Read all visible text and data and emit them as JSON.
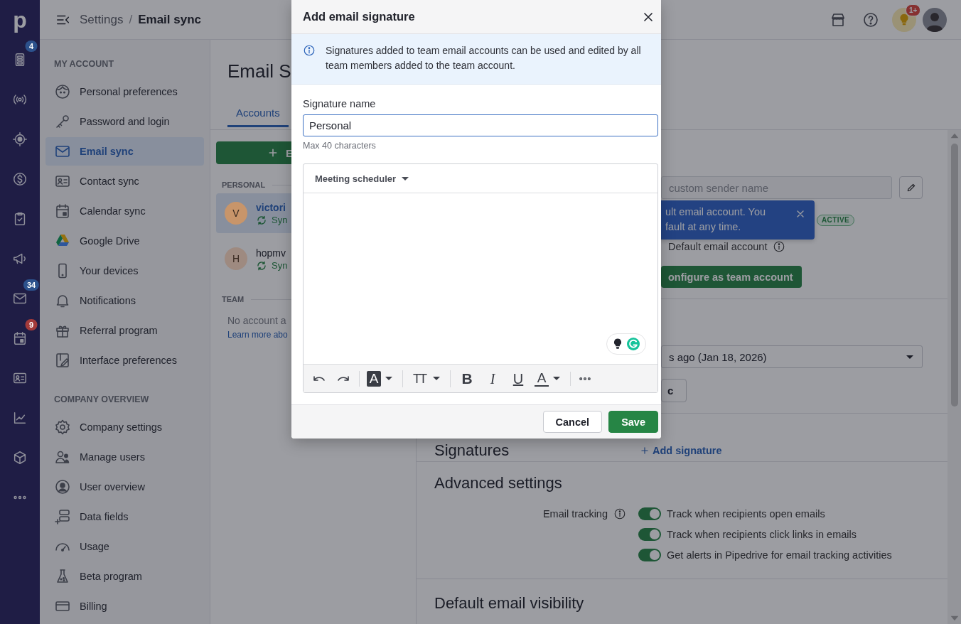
{
  "rail": {
    "logo": "p",
    "items": [
      {
        "kind": "inbox-list",
        "badge": "4",
        "color": "#2c518c"
      },
      {
        "kind": "broadcast"
      },
      {
        "kind": "target"
      },
      {
        "kind": "dollar"
      },
      {
        "kind": "clipboard"
      },
      {
        "kind": "megaphone"
      },
      {
        "kind": "mail",
        "badge": "34",
        "color": "#2c518c"
      },
      {
        "kind": "calendar",
        "badge": "9",
        "color": "#a33a3a"
      },
      {
        "kind": "contact-card"
      },
      {
        "kind": "chart"
      },
      {
        "kind": "box"
      },
      {
        "kind": "more"
      }
    ]
  },
  "header": {
    "breadcrumb": [
      "Settings",
      "Email sync"
    ],
    "separator": "/",
    "tips_badge": "1+"
  },
  "sidebar": {
    "sections": [
      {
        "title": "MY ACCOUNT",
        "items": [
          {
            "label": "Personal preferences",
            "kind": "face",
            "selected": false
          },
          {
            "label": "Password and login",
            "kind": "key",
            "selected": false
          },
          {
            "label": "Email sync",
            "kind": "mail",
            "selected": true
          },
          {
            "label": "Contact sync",
            "kind": "contact-card",
            "selected": false
          },
          {
            "label": "Calendar sync",
            "kind": "calendar",
            "selected": false
          },
          {
            "label": "Google Drive",
            "kind": "triangle",
            "selected": false
          },
          {
            "label": "Your devices",
            "kind": "phone",
            "selected": false
          },
          {
            "label": "Notifications",
            "kind": "bell",
            "selected": false
          },
          {
            "label": "Referral program",
            "kind": "gift",
            "selected": false
          },
          {
            "label": "Interface preferences",
            "kind": "panel-pencil",
            "selected": false
          }
        ]
      },
      {
        "title": "COMPANY OVERVIEW",
        "items": [
          {
            "label": "Company settings",
            "kind": "gear",
            "selected": false
          },
          {
            "label": "Manage users",
            "kind": "users",
            "selected": false
          },
          {
            "label": "User overview",
            "kind": "user-circle",
            "selected": false
          },
          {
            "label": "Data fields",
            "kind": "fields",
            "selected": false
          },
          {
            "label": "Usage",
            "kind": "gauge",
            "selected": false
          },
          {
            "label": "Beta program",
            "kind": "flask",
            "selected": false
          },
          {
            "label": "Billing",
            "kind": "card",
            "selected": false
          }
        ]
      }
    ]
  },
  "page_title": "Email S",
  "tabs": [
    {
      "label": "Accounts",
      "selected": true
    }
  ],
  "accounts_panel": {
    "add_button": "E",
    "groups": [
      {
        "title": "PERSONAL",
        "accounts": [
          {
            "initial": "V",
            "name": "victori",
            "status": "Syn",
            "color": "#c8956a",
            "selected": true
          },
          {
            "initial": "H",
            "name": "hopmv",
            "status": "Syn",
            "color": "#9e8a80",
            "selected": false
          }
        ]
      },
      {
        "title": "TEAM",
        "empty_text": "No account a",
        "link": "Learn more abo"
      }
    ]
  },
  "account_detail": {
    "sender_name": {
      "placeholder": "custom sender name"
    },
    "status_badge": "ACTIVE",
    "default_account": "Default email account",
    "team_button": "onfigure as team account",
    "sync_range": {
      "value": "s ago (Jan 18, 2026)"
    },
    "sync_button": "c",
    "signatures": {
      "title": "Signatures",
      "add_link": "Add signature"
    },
    "advanced": {
      "title": "Advanced settings",
      "tracking_label": "Email tracking",
      "options": [
        {
          "label": "Track when recipients open emails",
          "on": true
        },
        {
          "label": "Track when recipients click links in emails",
          "on": true
        },
        {
          "label": "Get alerts in Pipedrive for email tracking activities",
          "on": true
        }
      ]
    },
    "visibility_title": "Default email visibility"
  },
  "tooltip": {
    "lines": [
      "ult email account. You",
      "fault at any time."
    ]
  },
  "modal": {
    "title": "Add email signature",
    "notice": "Signatures added to team email accounts can be used and edited by all team members added to the team account.",
    "name_label": "Signature name",
    "name_value": "Personal",
    "name_hint": "Max 40 characters",
    "editor": {
      "template_menu": "Meeting scheduler",
      "toolbar": [
        [
          {
            "kind": "undo",
            "dropdown": false
          },
          {
            "kind": "redo",
            "dropdown": false
          }
        ],
        [
          {
            "kind": "highlight",
            "label": "A",
            "dropdown": true
          }
        ],
        [
          {
            "kind": "size",
            "label": "TT",
            "dropdown": true
          }
        ],
        [
          {
            "kind": "bold",
            "label": "B",
            "dropdown": false
          },
          {
            "kind": "italic",
            "label": "I",
            "dropdown": false
          },
          {
            "kind": "underline",
            "label": "U",
            "dropdown": false
          },
          {
            "kind": "color",
            "label": "A",
            "dropdown": true
          }
        ],
        [
          {
            "kind": "more",
            "dropdown": false
          }
        ]
      ]
    },
    "buttons": [
      {
        "label": "Cancel",
        "kind": "secondary"
      },
      {
        "label": "Save",
        "kind": "primary"
      }
    ]
  }
}
